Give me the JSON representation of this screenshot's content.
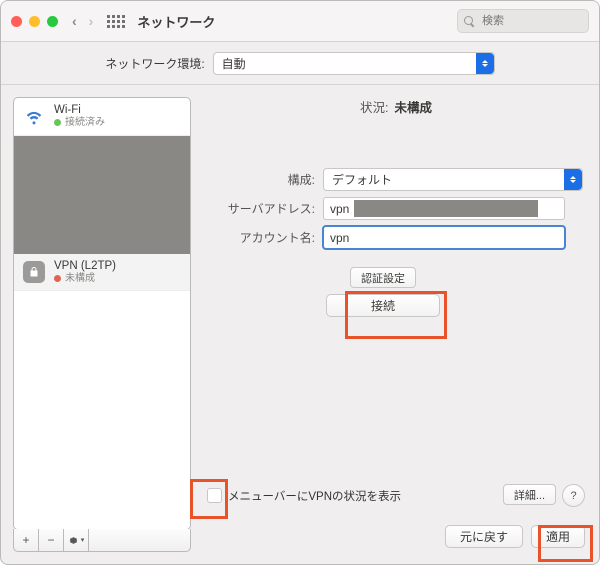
{
  "titlebar": {
    "title": "ネットワーク",
    "search_placeholder": "検索"
  },
  "location": {
    "label": "ネットワーク環境:",
    "value": "自動"
  },
  "sidebar": {
    "services": [
      {
        "name": "Wi-Fi",
        "status": "接続済み",
        "dot": "green",
        "icon": "wifi"
      },
      {
        "name": "VPN (L2TP)",
        "status": "未構成",
        "dot": "red",
        "icon": "lock"
      }
    ],
    "add": "+",
    "remove": "−",
    "gear": "⋮"
  },
  "detail": {
    "status_label": "状況:",
    "status_value": "未構成",
    "config_label": "構成:",
    "config_value": "デフォルト",
    "server_label": "サーバアドレス:",
    "server_value": "vpn",
    "account_label": "アカウント名:",
    "account_value": "vpn",
    "auth_button": "認証設定",
    "connect_button": "接続",
    "menubar_checkbox_label": "メニューバーにVPNの状況を表示",
    "advanced_button": "詳細...",
    "help": "?"
  },
  "actions": {
    "revert": "元に戻す",
    "apply": "適用"
  }
}
